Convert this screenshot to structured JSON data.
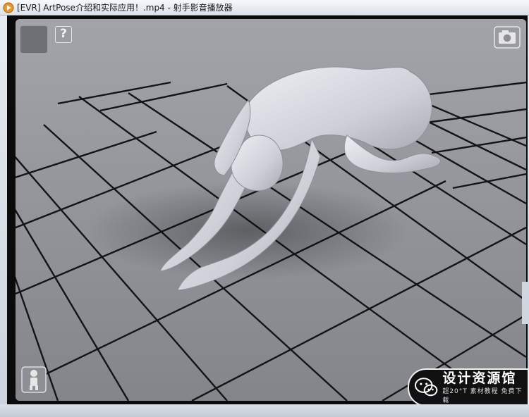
{
  "window": {
    "title": "[EVR] ArtPose介绍和实际应用！.mp4 - 射手影音播放器"
  },
  "viewer": {
    "help_label": "?"
  },
  "watermark": {
    "title": "设计资源馆",
    "subtitle": "超20°T 素材教程 免费下载"
  },
  "colors": {
    "floor": "#8d8f95",
    "grid": "#141414",
    "figure": "#d8d8e0",
    "watermark_bg": "#111111"
  },
  "icons": {
    "app": "player-icon",
    "camera": "camera-icon",
    "mannequin": "mannequin-icon",
    "logo": "wechat-icon"
  }
}
